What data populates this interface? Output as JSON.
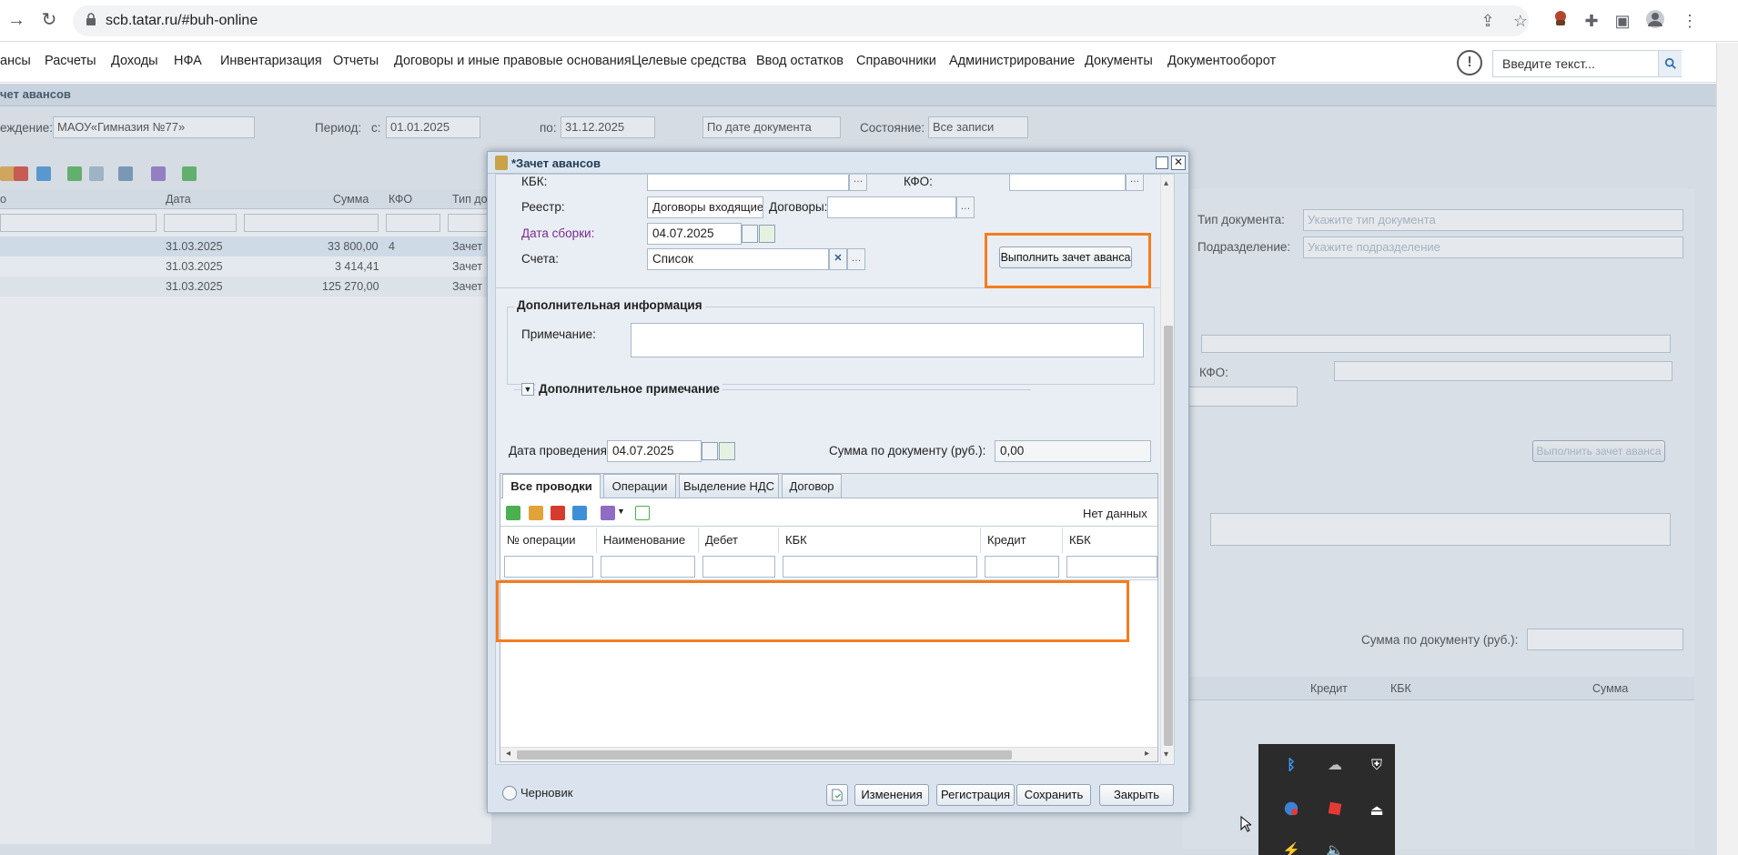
{
  "browser": {
    "url": "scb.tatar.ru/#buh-online"
  },
  "menu": {
    "items": [
      "анcы",
      "Расчеты",
      "Доходы",
      "НФА",
      "Инвентаризация",
      "Отчеты",
      "Договоры и иные правовые основания",
      "Целевые средства",
      "Ввод остатков",
      "Справочники",
      "Администрирование",
      "Документы",
      "Документооборот"
    ],
    "search_placeholder": "Введите текст..."
  },
  "background": {
    "window_title": "чет авансов",
    "org_label": "еждение:",
    "org_value": "МАОУ«Гимназия №77»",
    "period_label": "Период:",
    "period_from_label": "с:",
    "period_from": "01.01.2025",
    "period_to_label": "по:",
    "period_to": "31.12.2025",
    "date_mode": "По дате документа",
    "state_label": "Состояние:",
    "state_value": "Все записи",
    "grid_headers": [
      "о",
      "Дата",
      "Сумма",
      "КФО",
      "Тип до"
    ],
    "rows": [
      {
        "date": "31.03.2025",
        "sum": "33 800,00",
        "kfo": "4",
        "type": "Зачет"
      },
      {
        "date": "31.03.2025",
        "sum": "3 414,41",
        "kfo": "",
        "type": "Зачет"
      },
      {
        "date": "31.03.2025",
        "sum": "125 270,00",
        "kfo": "",
        "type": "Зачет"
      }
    ],
    "right_doc_type_label": "Тип документа:",
    "right_doc_type_ph": "Укажите тип документа",
    "right_dept_label": "Подразделение:",
    "right_dept_ph": "Укажите подразделение",
    "right_kfo_label": "КФО:",
    "right_btn": "Выполнить зачет аванса",
    "right_sum_label": "Сумма по документу (руб.):",
    "right_grid_headers": [
      "Кредит",
      "КБК",
      "Сумма"
    ]
  },
  "modal": {
    "title": "*Зачет авансов",
    "kbk_label": "КБК:",
    "kfo_label": "КФО:",
    "registry_label": "Реестр:",
    "registry_value": "Договоры входящие",
    "contracts_label": "Договоры:",
    "assembly_date_label": "Дата сборки:",
    "assembly_date": "04.07.2025",
    "accounts_label": "Счета:",
    "accounts_value": "Список",
    "execute_button": "Выполнить зачет аванса",
    "extra_info_legend": "Дополнительная информация",
    "note_label": "Примечание:",
    "extra_note_legend": "Дополнительное примечание",
    "posting_date_label": "Дата проведения:",
    "posting_date": "04.07.2025",
    "doc_sum_label": "Сумма по документу (руб.):",
    "doc_sum": "0,00",
    "tabs": [
      "Все проводки",
      "Операции",
      "Выделение НДС",
      "Договор"
    ],
    "no_data": "Нет данных",
    "columns": [
      "№ операции",
      "Наименование",
      "Дебет",
      "КБК",
      "Кредит",
      "КБК"
    ],
    "status": "Черновик",
    "footer_buttons": [
      "Изменения",
      "Регистрация",
      "Сохранить",
      "Закрыть"
    ]
  },
  "colors": {
    "highlight": "#f57c1f",
    "link_label": "#7b2c8f"
  }
}
